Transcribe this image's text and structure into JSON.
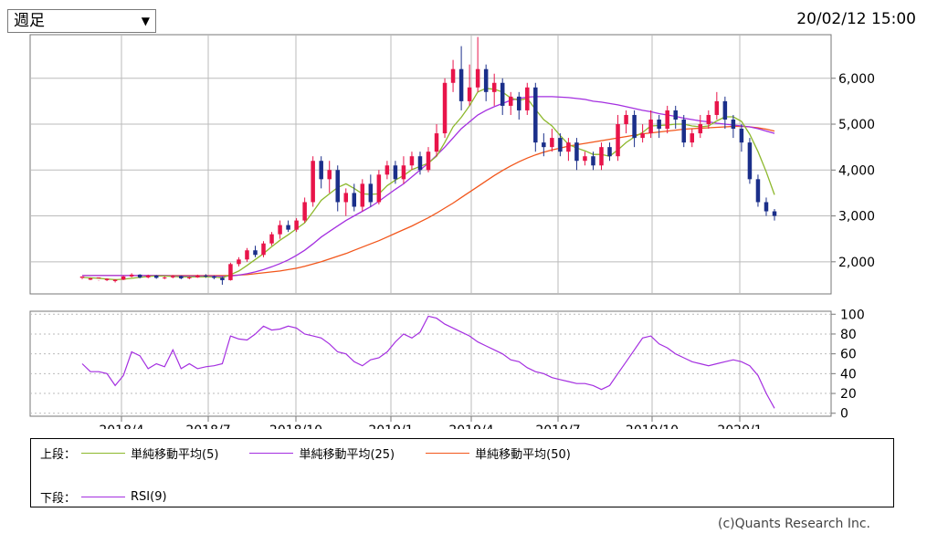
{
  "header": {
    "period_selected": "週足",
    "timestamp": "20/02/12 15:00"
  },
  "legend": {
    "upper_label": "上段：",
    "lower_label": "下段：",
    "items_upper": [
      {
        "label": "単純移動平均(5)",
        "color": "#8db82c"
      },
      {
        "label": "単純移動平均(25)",
        "color": "#a42fe0"
      },
      {
        "label": "単純移動平均(50)",
        "color": "#f2561b"
      }
    ],
    "items_lower": [
      {
        "label": "RSI(9)",
        "color": "#a42fe0"
      }
    ]
  },
  "copyright": "(c)Quants Research Inc.",
  "colors": {
    "up": "#e8144a",
    "down": "#1b2f8a",
    "rsi": "#a42fe0"
  },
  "chart_data": {
    "type": "candlestick",
    "x_tick_labels": [
      "2018/4",
      "2018/7",
      "2018/10",
      "2019/1",
      "2019/4",
      "2019/7",
      "2019/10",
      "2020/1"
    ],
    "price_axis": {
      "ticks": [
        "2,000",
        "3,000",
        "4,000",
        "5,000",
        "6,000"
      ],
      "ylim": [
        1300,
        6950
      ]
    },
    "rsi_axis": {
      "ticks": [
        "0",
        "20",
        "40",
        "60",
        "80",
        "100"
      ],
      "ylim": [
        -3,
        103
      ]
    },
    "candles": [
      [
        1650,
        1680,
        1640,
        1620
      ],
      [
        1610,
        1640,
        1650,
        1600
      ],
      [
        1640,
        1660,
        1600,
        1590
      ],
      [
        1600,
        1630,
        1640,
        1580
      ],
      [
        1580,
        1610,
        1620,
        1550
      ],
      [
        1610,
        1680,
        1700,
        1600
      ],
      [
        1680,
        1720,
        1750,
        1660
      ],
      [
        1720,
        1660,
        1730,
        1640
      ],
      [
        1660,
        1700,
        1720,
        1640
      ],
      [
        1700,
        1650,
        1710,
        1630
      ],
      [
        1650,
        1660,
        1680,
        1620
      ],
      [
        1660,
        1690,
        1710,
        1640
      ],
      [
        1690,
        1640,
        1700,
        1620
      ],
      [
        1640,
        1660,
        1680,
        1620
      ],
      [
        1660,
        1700,
        1720,
        1650
      ],
      [
        1700,
        1680,
        1730,
        1650
      ],
      [
        1680,
        1650,
        1700,
        1620
      ],
      [
        1650,
        1600,
        1670,
        1500
      ],
      [
        1600,
        1950,
        1980,
        1590
      ],
      [
        1950,
        2050,
        2100,
        1900
      ],
      [
        2050,
        2250,
        2300,
        2000
      ],
      [
        2250,
        2150,
        2350,
        2100
      ],
      [
        2150,
        2400,
        2450,
        2100
      ],
      [
        2400,
        2600,
        2650,
        2350
      ],
      [
        2600,
        2800,
        2900,
        2500
      ],
      [
        2800,
        2700,
        2900,
        2650
      ],
      [
        2700,
        2900,
        2950,
        2650
      ],
      [
        2900,
        3300,
        3400,
        2850
      ],
      [
        3300,
        4200,
        4300,
        3200
      ],
      [
        4200,
        3800,
        4300,
        3600
      ],
      [
        3800,
        4000,
        4200,
        3500
      ],
      [
        4000,
        3300,
        4100,
        3100
      ],
      [
        3300,
        3500,
        3600,
        3000
      ],
      [
        3500,
        3200,
        3700,
        3100
      ],
      [
        3200,
        3700,
        3800,
        3100
      ],
      [
        3700,
        3300,
        3900,
        3200
      ],
      [
        3300,
        3900,
        4000,
        3250
      ],
      [
        3900,
        4100,
        4200,
        3800
      ],
      [
        4100,
        3800,
        4200,
        3700
      ],
      [
        3800,
        4100,
        4300,
        3700
      ],
      [
        4100,
        4300,
        4400,
        4000
      ],
      [
        4300,
        4000,
        4400,
        3900
      ],
      [
        4000,
        4400,
        4500,
        3950
      ],
      [
        4400,
        4800,
        5000,
        4300
      ],
      [
        4800,
        5900,
        6000,
        4700
      ],
      [
        5900,
        6200,
        6400,
        5700
      ],
      [
        6200,
        5500,
        6700,
        5300
      ],
      [
        5500,
        5800,
        6300,
        5400
      ],
      [
        5800,
        6200,
        6900,
        5700
      ],
      [
        6200,
        5700,
        6300,
        5500
      ],
      [
        5700,
        5900,
        6100,
        5400
      ],
      [
        5900,
        5400,
        6000,
        5200
      ],
      [
        5400,
        5600,
        5700,
        5200
      ],
      [
        5600,
        5300,
        5700,
        5100
      ],
      [
        5300,
        5800,
        5900,
        5200
      ],
      [
        5800,
        4600,
        5900,
        4400
      ],
      [
        4600,
        4500,
        4800,
        4300
      ],
      [
        4500,
        4700,
        4900,
        4400
      ],
      [
        4700,
        4400,
        4800,
        4300
      ],
      [
        4400,
        4600,
        4700,
        4200
      ],
      [
        4600,
        4200,
        4700,
        4000
      ],
      [
        4200,
        4300,
        4400,
        4100
      ],
      [
        4300,
        4100,
        4400,
        4000
      ],
      [
        4100,
        4500,
        4600,
        4000
      ],
      [
        4500,
        4300,
        4600,
        4200
      ],
      [
        4300,
        5000,
        5200,
        4200
      ],
      [
        5000,
        5200,
        5300,
        4800
      ],
      [
        5200,
        4700,
        5300,
        4500
      ],
      [
        4700,
        4800,
        5000,
        4600
      ],
      [
        4800,
        5100,
        5300,
        4700
      ],
      [
        5100,
        4900,
        5200,
        4700
      ],
      [
        4900,
        5300,
        5400,
        4800
      ],
      [
        5300,
        5100,
        5400,
        4900
      ],
      [
        5100,
        4600,
        5200,
        4500
      ],
      [
        4600,
        4800,
        4900,
        4500
      ],
      [
        4800,
        5000,
        5200,
        4700
      ],
      [
        5000,
        5200,
        5300,
        4900
      ],
      [
        5200,
        5500,
        5700,
        5100
      ],
      [
        5500,
        5100,
        5600,
        4900
      ],
      [
        5100,
        4900,
        5200,
        4700
      ],
      [
        4900,
        4600,
        5000,
        4400
      ],
      [
        4600,
        3800,
        4700,
        3700
      ],
      [
        3800,
        3300,
        3900,
        3200
      ],
      [
        3300,
        3100,
        3400,
        3000
      ],
      [
        3100,
        3000,
        3150,
        2900
      ]
    ],
    "series": [
      {
        "name": "単純移動平均(5)",
        "values": [
          1660,
          1650,
          1640,
          1625,
          1610,
          1620,
          1640,
          1660,
          1680,
          1690,
          1690,
          1680,
          1670,
          1670,
          1670,
          1670,
          1670,
          1650,
          1720,
          1800,
          1920,
          2050,
          2180,
          2330,
          2470,
          2590,
          2720,
          2850,
          3090,
          3340,
          3480,
          3620,
          3700,
          3600,
          3480,
          3470,
          3480,
          3660,
          3780,
          3880,
          4010,
          4080,
          4150,
          4300,
          4600,
          4940,
          5150,
          5400,
          5700,
          5780,
          5760,
          5700,
          5570,
          5520,
          5560,
          5320,
          5100,
          4960,
          4750,
          4560,
          4480,
          4420,
          4340,
          4340,
          4300,
          4440,
          4600,
          4720,
          4820,
          4960,
          4970,
          4980,
          5000,
          5000,
          4960,
          4940,
          4960,
          5070,
          5160,
          5160,
          5060,
          4780,
          4400,
          3960,
          3460
        ]
      },
      {
        "name": "単純移動平均(25)",
        "values": [
          1700,
          1700,
          1700,
          1700,
          1700,
          1700,
          1700,
          1700,
          1700,
          1700,
          1700,
          1690,
          1690,
          1690,
          1690,
          1690,
          1690,
          1680,
          1690,
          1710,
          1740,
          1780,
          1830,
          1890,
          1960,
          2040,
          2140,
          2250,
          2390,
          2540,
          2660,
          2780,
          2900,
          3000,
          3100,
          3200,
          3320,
          3450,
          3580,
          3700,
          3850,
          4000,
          4150,
          4320,
          4500,
          4700,
          4900,
          5050,
          5200,
          5300,
          5380,
          5450,
          5520,
          5560,
          5590,
          5600,
          5600,
          5600,
          5590,
          5580,
          5560,
          5540,
          5500,
          5480,
          5450,
          5420,
          5380,
          5340,
          5300,
          5270,
          5230,
          5200,
          5170,
          5130,
          5100,
          5070,
          5050,
          5020,
          5000,
          4980,
          4960,
          4940,
          4900,
          4850,
          4800
        ]
      },
      {
        "name": "単純移動平均(50)",
        "values": [
          1700,
          1700,
          1700,
          1700,
          1700,
          1700,
          1700,
          1700,
          1700,
          1700,
          1700,
          1700,
          1700,
          1700,
          1700,
          1700,
          1700,
          1700,
          1700,
          1710,
          1720,
          1740,
          1760,
          1780,
          1800,
          1830,
          1860,
          1900,
          1950,
          2000,
          2060,
          2120,
          2180,
          2250,
          2320,
          2390,
          2460,
          2540,
          2620,
          2700,
          2780,
          2870,
          2960,
          3060,
          3170,
          3280,
          3400,
          3520,
          3640,
          3760,
          3880,
          3990,
          4090,
          4180,
          4260,
          4330,
          4390,
          4440,
          4480,
          4520,
          4550,
          4580,
          4610,
          4640,
          4670,
          4700,
          4730,
          4760,
          4790,
          4810,
          4830,
          4850,
          4870,
          4890,
          4900,
          4910,
          4920,
          4930,
          4940,
          4950,
          4950,
          4940,
          4920,
          4890,
          4850
        ]
      },
      {
        "name": "RSI(9)",
        "values": [
          50,
          42,
          42,
          40,
          28,
          38,
          62,
          58,
          45,
          50,
          47,
          64,
          45,
          50,
          45,
          47,
          48,
          50,
          78,
          75,
          74,
          80,
          88,
          84,
          85,
          88,
          86,
          80,
          78,
          76,
          70,
          62,
          60,
          52,
          48,
          54,
          56,
          62,
          72,
          80,
          76,
          82,
          98,
          96,
          90,
          86,
          82,
          78,
          72,
          68,
          64,
          60,
          54,
          52,
          46,
          42,
          40,
          36,
          34,
          32,
          30,
          30,
          28,
          24,
          28,
          40,
          52,
          64,
          76,
          78,
          70,
          66,
          60,
          56,
          52,
          50,
          48,
          50,
          52,
          54,
          52,
          48,
          38,
          20,
          5
        ]
      }
    ]
  }
}
